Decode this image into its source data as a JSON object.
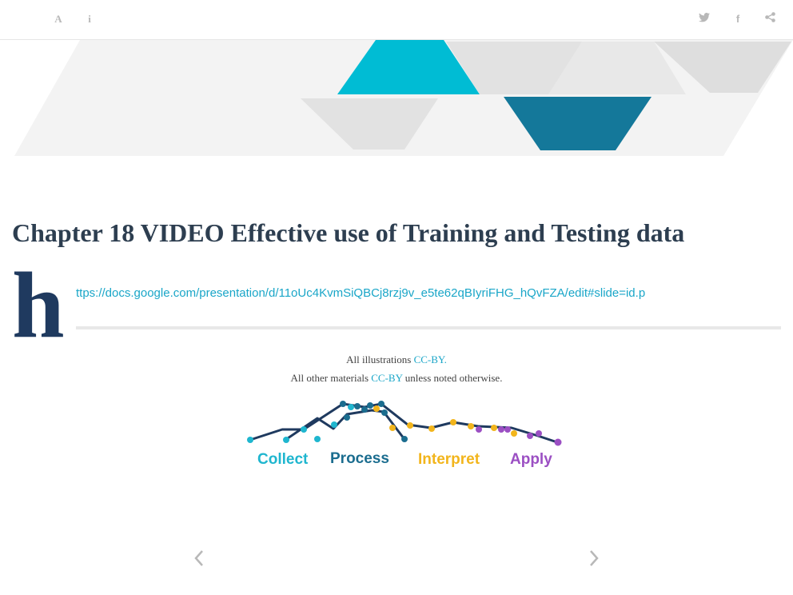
{
  "toolbar": {
    "left_icons": [
      "font-size-icon",
      "info-icon"
    ],
    "right_icons": [
      "twitter-icon",
      "facebook-icon",
      "share-icon"
    ]
  },
  "banner": {
    "colors": {
      "cyan": "#00bcd4",
      "teal_dark": "#14789a",
      "grey": "#ececec"
    }
  },
  "chapter": {
    "title": "Chapter 18   VIDEO Effective use of Training and Testing data",
    "dropcap": "h",
    "link_text": "ttps://docs.google.com/presentation/d/11oUc4KvmSiQBCj8rzj9v_e5te62qBIyriFHG_hQvFZA/edit#slide=id.p"
  },
  "license": {
    "line1_prefix": "All illustrations ",
    "line1_link": "CC-BY.",
    "line2_prefix": "All other materials ",
    "line2_link": "CC-BY",
    "line2_suffix": " unless noted otherwise."
  },
  "data_cycle": {
    "labels": [
      "Collect",
      "Process",
      "Interpret",
      "Apply"
    ],
    "colors": {
      "collect": "#1fb6cf",
      "process": "#1b6d8f",
      "interpret": "#f2b51c",
      "apply": "#9b4fc3",
      "line": "#1f3a5f"
    }
  },
  "navigation": {
    "prev_icon": "chevron-left-icon",
    "next_icon": "chevron-right-icon"
  }
}
